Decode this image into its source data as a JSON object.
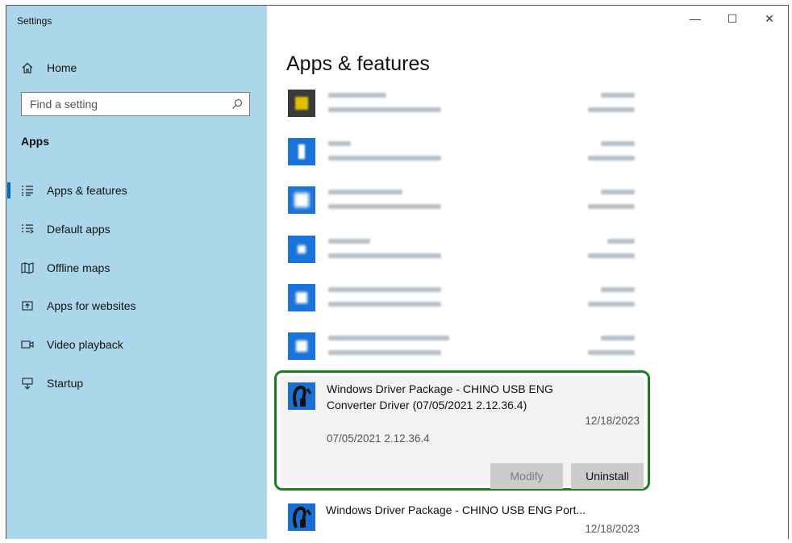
{
  "window": {
    "title": "Settings",
    "controls": {
      "minimize": "—",
      "maximize": "☐",
      "close": "✕"
    }
  },
  "sidebar": {
    "home_label": "Home",
    "search_placeholder": "Find a setting",
    "section_title": "Apps",
    "items": [
      {
        "label": "Apps & features",
        "icon": "list-icon",
        "active": true
      },
      {
        "label": "Default apps",
        "icon": "default-apps-icon",
        "active": false
      },
      {
        "label": "Offline maps",
        "icon": "map-icon",
        "active": false
      },
      {
        "label": "Apps for websites",
        "icon": "web-apps-icon",
        "active": false
      },
      {
        "label": "Video playback",
        "icon": "video-icon",
        "active": false
      },
      {
        "label": "Startup",
        "icon": "startup-icon",
        "active": false
      }
    ]
  },
  "main": {
    "page_title": "Apps & features",
    "blurred_apps": [
      {
        "icon_color": "#3a3a3a",
        "icon_inner": "#e0c000"
      },
      {
        "icon_color": "#1a73d9",
        "icon_inner": "#ffffff"
      },
      {
        "icon_color": "#1a73d9",
        "icon_inner": "#ffffff"
      },
      {
        "icon_color": "#1a73d9",
        "icon_inner": "#ffffff"
      },
      {
        "icon_color": "#1a73d9",
        "icon_inner": "#ffffff"
      },
      {
        "icon_color": "#1a73d9",
        "icon_inner": "#ffffff"
      }
    ],
    "selected_app": {
      "name_line1": "Windows Driver Package - CHINO USB ENG",
      "name_line2": "Converter Driver (07/05/2021 2.12.36.4)",
      "date": "12/18/2023",
      "version": "07/05/2021 2.12.36.4",
      "modify_label": "Modify",
      "uninstall_label": "Uninstall"
    },
    "next_app": {
      "name": "Windows Driver Package - CHINO USB ENG Port...",
      "date": "12/18/2023"
    }
  },
  "colors": {
    "sidebar_bg": "#acd6ea",
    "highlight_border": "#1c7f1c",
    "accent": "#0067c0"
  }
}
